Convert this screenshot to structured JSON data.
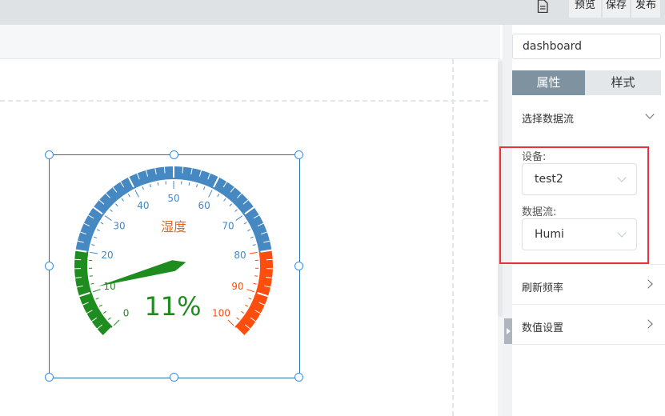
{
  "toolbar": {
    "doc_icon": "document-icon",
    "preview_label": "预览",
    "save_label": "保存",
    "publish_label": "发布"
  },
  "panel": {
    "name_value": "dashboard",
    "tabs": [
      "属性",
      "样式"
    ],
    "active_tab": "属性",
    "datastream_section": {
      "title": "选择数据流",
      "expanded": true,
      "device_label": "设备:",
      "device_value": "test2",
      "stream_label": "数据流:",
      "stream_value": "Humi"
    },
    "refresh_title": "刷新频率",
    "value_settings_title": "数值设置"
  },
  "gauge": {
    "title": "湿度",
    "value": 11,
    "value_text": "11%",
    "min": 0,
    "max": 100,
    "tick_labels": [
      "0",
      "10",
      "20",
      "30",
      "40",
      "50",
      "60",
      "70",
      "80",
      "90",
      "100"
    ],
    "colors": {
      "low": "#1e8c1e",
      "mid": "#4588c2",
      "high": "#ff4d0d",
      "pointer": "#1e8c1e",
      "title": "#f0641e"
    }
  },
  "colors": {
    "tab_active_bg": "#7e939f",
    "highlight_box": "#e8323c",
    "selection_border": "#2b6fa8"
  }
}
